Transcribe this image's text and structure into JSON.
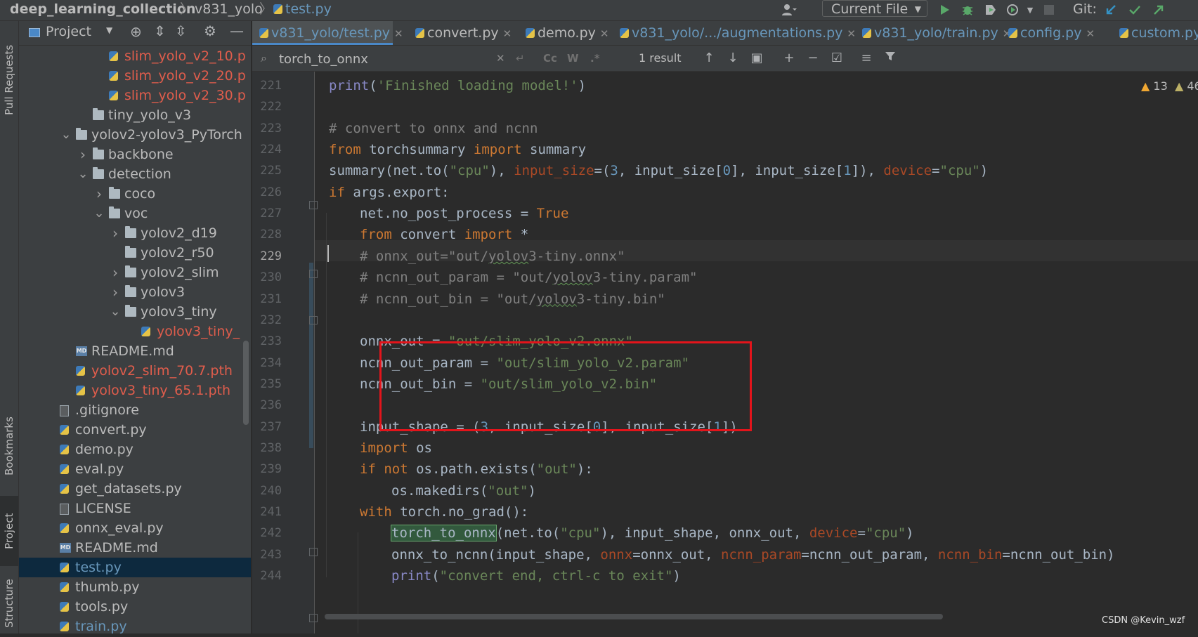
{
  "navbar": {
    "project": "deep_learning_collection",
    "folder": "v831_yolo",
    "file": "test.py",
    "run_config": "Current File",
    "git_label": "Git:"
  },
  "left_stripe": [
    "Pull Requests",
    "Bookmarks",
    "Project",
    "Structure"
  ],
  "project_panel": {
    "title": "Project",
    "tree": [
      {
        "label": "slim_yolo_v2_10.p",
        "type": "py",
        "color": "red"
      },
      {
        "label": "slim_yolo_v2_20.p",
        "type": "py",
        "color": "red"
      },
      {
        "label": "slim_yolo_v2_30.p",
        "type": "py",
        "color": "red"
      },
      {
        "label": "tiny_yolo_v3",
        "type": "folder"
      },
      {
        "label": "yolov2-yolov3_PyTorch",
        "type": "folder",
        "arrow": "down"
      },
      {
        "label": "backbone",
        "type": "folder",
        "arrow": "right"
      },
      {
        "label": "detection",
        "type": "folder",
        "arrow": "down"
      },
      {
        "label": "coco",
        "type": "folder",
        "arrow": "right"
      },
      {
        "label": "voc",
        "type": "folder",
        "arrow": "down"
      },
      {
        "label": "yolov2_d19",
        "type": "folder",
        "arrow": "right"
      },
      {
        "label": "yolov2_r50",
        "type": "folder"
      },
      {
        "label": "yolov2_slim",
        "type": "folder",
        "arrow": "right"
      },
      {
        "label": "yolov3",
        "type": "folder",
        "arrow": "right"
      },
      {
        "label": "yolov3_tiny",
        "type": "folder",
        "arrow": "down"
      },
      {
        "label": "yolov3_tiny_",
        "type": "py",
        "color": "red"
      },
      {
        "label": "README.md",
        "type": "md"
      },
      {
        "label": "yolov2_slim_70.7.pth",
        "type": "py",
        "color": "red"
      },
      {
        "label": "yolov3_tiny_65.1.pth",
        "type": "py",
        "color": "red"
      },
      {
        "label": ".gitignore",
        "type": "file"
      },
      {
        "label": "convert.py",
        "type": "py"
      },
      {
        "label": "demo.py",
        "type": "py"
      },
      {
        "label": "eval.py",
        "type": "py"
      },
      {
        "label": "get_datasets.py",
        "type": "py"
      },
      {
        "label": "LICENSE",
        "type": "file"
      },
      {
        "label": "onnx_eval.py",
        "type": "py"
      },
      {
        "label": "README.md",
        "type": "md"
      },
      {
        "label": "test.py",
        "type": "py",
        "selected": true,
        "color": "blue"
      },
      {
        "label": "thumb.py",
        "type": "py"
      },
      {
        "label": "tools.py",
        "type": "py"
      },
      {
        "label": "train.py",
        "type": "py",
        "color": "blue"
      }
    ]
  },
  "tabs": [
    {
      "label": "v831_yolo/test.py",
      "active": true
    },
    {
      "label": "convert.py"
    },
    {
      "label": "demo.py"
    },
    {
      "label": "v831_yolo/.../augmentations.py"
    },
    {
      "label": "v831_yolo/train.py"
    },
    {
      "label": "config.py"
    },
    {
      "label": "custom.py"
    }
  ],
  "find": {
    "query": "torch_to_onnx",
    "opt_case": "Cc",
    "opt_word": "W",
    "opt_regex": ".*",
    "result_count": "1 result"
  },
  "inspections": {
    "warnings": "13",
    "weak_warnings": "46"
  },
  "line_numbers": [
    "221",
    "222",
    "223",
    "224",
    "225",
    "226",
    "227",
    "228",
    "229",
    "230",
    "231",
    "232",
    "233",
    "234",
    "235",
    "236",
    "237",
    "238",
    "239",
    "240",
    "241",
    "242",
    "243",
    "244"
  ],
  "current_line": "229",
  "watermark": "CSDN @Kevin_wzf",
  "colors": {
    "highlight_box": "#e3141b",
    "accent": "#4a88c7"
  }
}
